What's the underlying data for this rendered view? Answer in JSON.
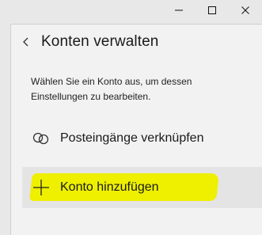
{
  "window": {
    "controls": [
      "minimize",
      "maximize",
      "close"
    ]
  },
  "header": {
    "back_icon": "chevron-left-icon",
    "title": "Konten verwalten"
  },
  "description": "Wählen Sie ein Konto aus, um dessen Einstellungen zu bearbeiten.",
  "items": [
    {
      "icon": "link-icon",
      "label": "Posteingänge verknüpfen"
    },
    {
      "icon": "plus-icon",
      "label": "Konto hinzufügen",
      "highlight_color": "#eef000"
    }
  ]
}
